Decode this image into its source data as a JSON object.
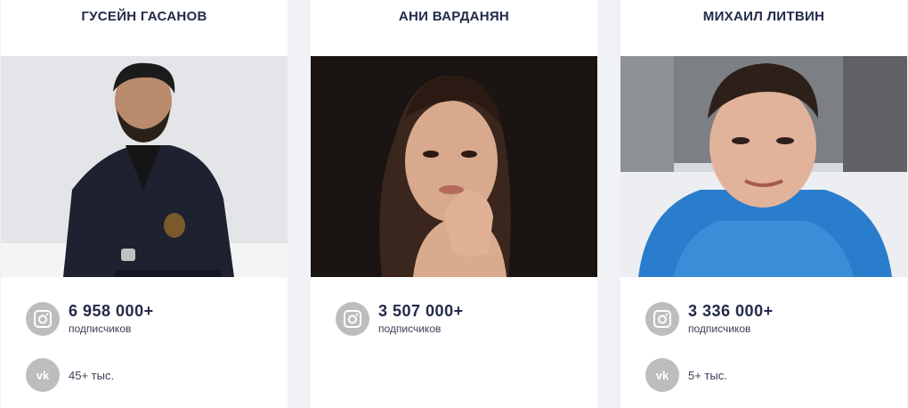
{
  "cards": [
    {
      "name": "ГУСЕЙН ГАСАНОВ",
      "instagram": {
        "icon": "instagram-icon",
        "count": "6 958 000+",
        "label": "подписчиков"
      },
      "vk": {
        "icon": "vk-icon",
        "count": "45+ тыс."
      }
    },
    {
      "name": "АНИ ВАРДАНЯН",
      "instagram": {
        "icon": "instagram-icon",
        "count": "3 507 000+",
        "label": "подписчиков"
      }
    },
    {
      "name": "МИХАИЛ ЛИТВИН",
      "instagram": {
        "icon": "instagram-icon",
        "count": "3 336 000+",
        "label": "подписчиков"
      },
      "vk": {
        "icon": "vk-icon",
        "count": "5+ тыс."
      }
    }
  ],
  "colors": {
    "page_background": "#f1f2f5",
    "card_background": "#ffffff",
    "heading_text": "#232a4a",
    "icon_circle": "#bdbdbd"
  }
}
